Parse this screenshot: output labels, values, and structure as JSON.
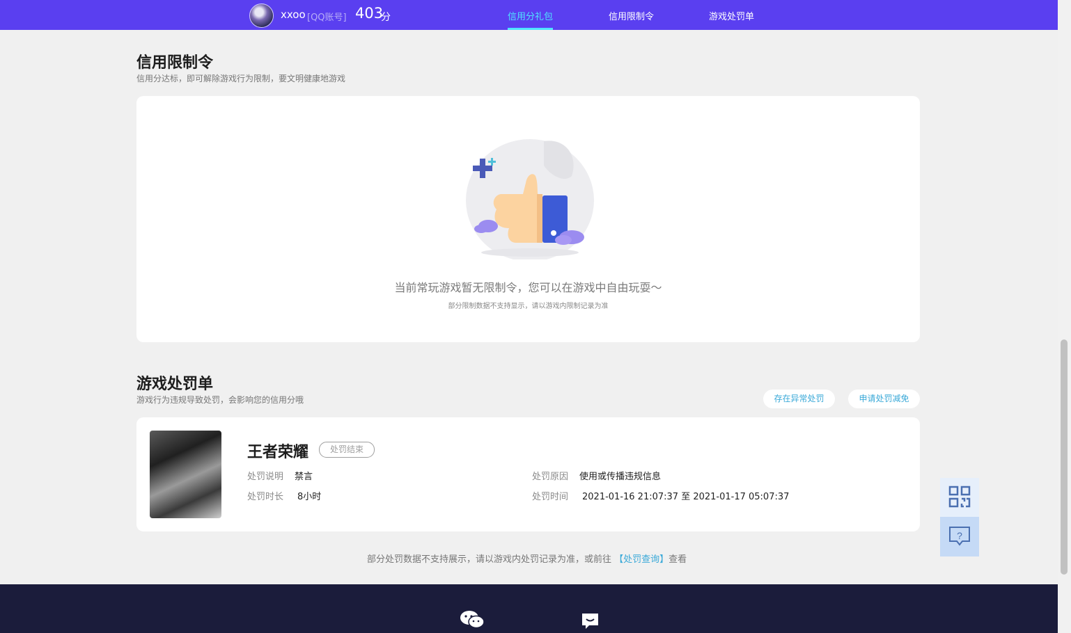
{
  "header": {
    "username": "xxoo",
    "account_type": "[QQ账号]",
    "score": "403",
    "score_unit": "分",
    "tabs": [
      {
        "label": "信用分礼包",
        "active": true
      },
      {
        "label": "信用限制令",
        "active": false
      },
      {
        "label": "游戏处罚单",
        "active": false
      }
    ]
  },
  "restriction": {
    "title": "信用限制令",
    "subtitle": "信用分达标，即可解除游戏行为限制，要文明健康地游戏",
    "empty_message": "当前常玩游戏暂无限制令，您可以在游戏中自由玩耍～",
    "empty_note": "部分限制数据不支持显示，请以游戏内限制记录为准"
  },
  "penalty": {
    "title": "游戏处罚单",
    "subtitle": "游戏行为违规导致处罚，会影响您的信用分哦",
    "buttons": {
      "abnormal": "存在异常处罚",
      "appeal": "申请处罚减免"
    },
    "record": {
      "game": "王者荣耀",
      "status": "处罚结束",
      "desc_label": "处罚说明",
      "desc_value": "禁言",
      "reason_label": "处罚原因",
      "reason_value": "使用或传播违规信息",
      "duration_label": "处罚时长",
      "duration_value": "8小时",
      "time_label": "处罚时间",
      "time_value": "2021-01-16 21:07:37 至 2021-01-17 05:07:37"
    },
    "footnote": {
      "before": "部分处罚数据不支持展示，请以游戏内处罚记录为准，或前往 ",
      "link": "【处罚查询】",
      "after": "查看"
    }
  },
  "colors": {
    "topbar": "#5a3ff0",
    "active_tab": "#4fe3ff",
    "link": "#3aa9d8",
    "footer": "#1b1c3b"
  },
  "icons": {
    "qr": "qr-code-icon",
    "help": "question-bubble-icon",
    "wechat": "wechat-icon",
    "chat": "chat-icon"
  }
}
